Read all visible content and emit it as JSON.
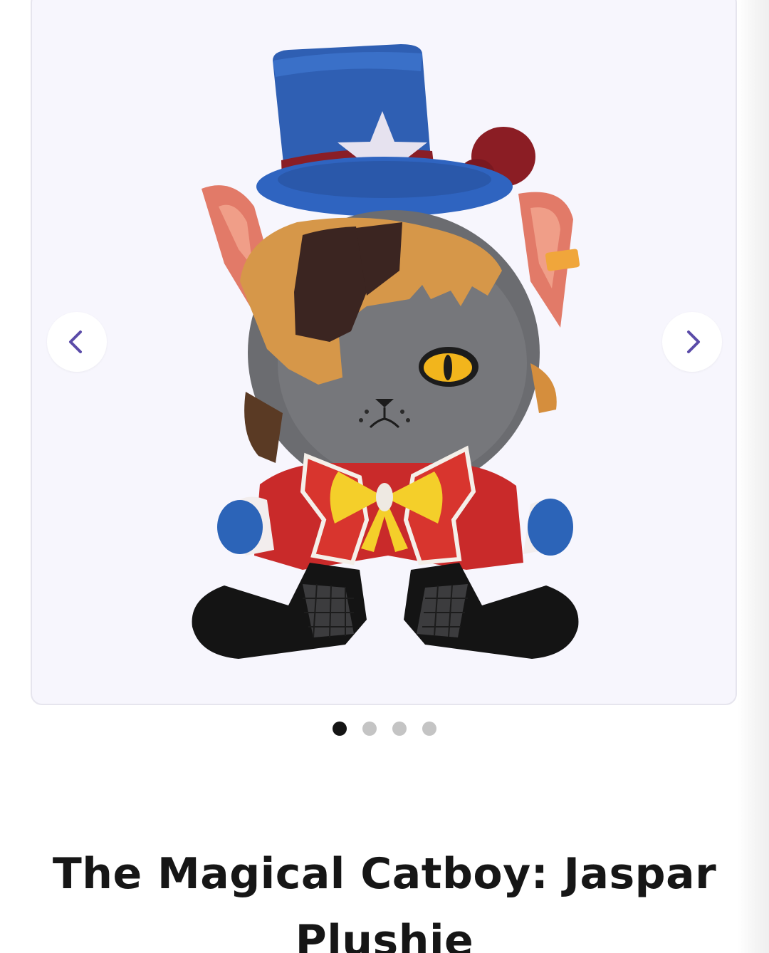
{
  "carousel": {
    "image_alt": "The Magical Catboy: Jaspar Plushie",
    "prev_icon": "chevron-left-icon",
    "next_icon": "chevron-right-icon",
    "slide_count": 4,
    "active_slide": 1,
    "accent_color": "#5a4ba8"
  },
  "product": {
    "title": "The Magical Catboy: Jaspar Plushie"
  }
}
